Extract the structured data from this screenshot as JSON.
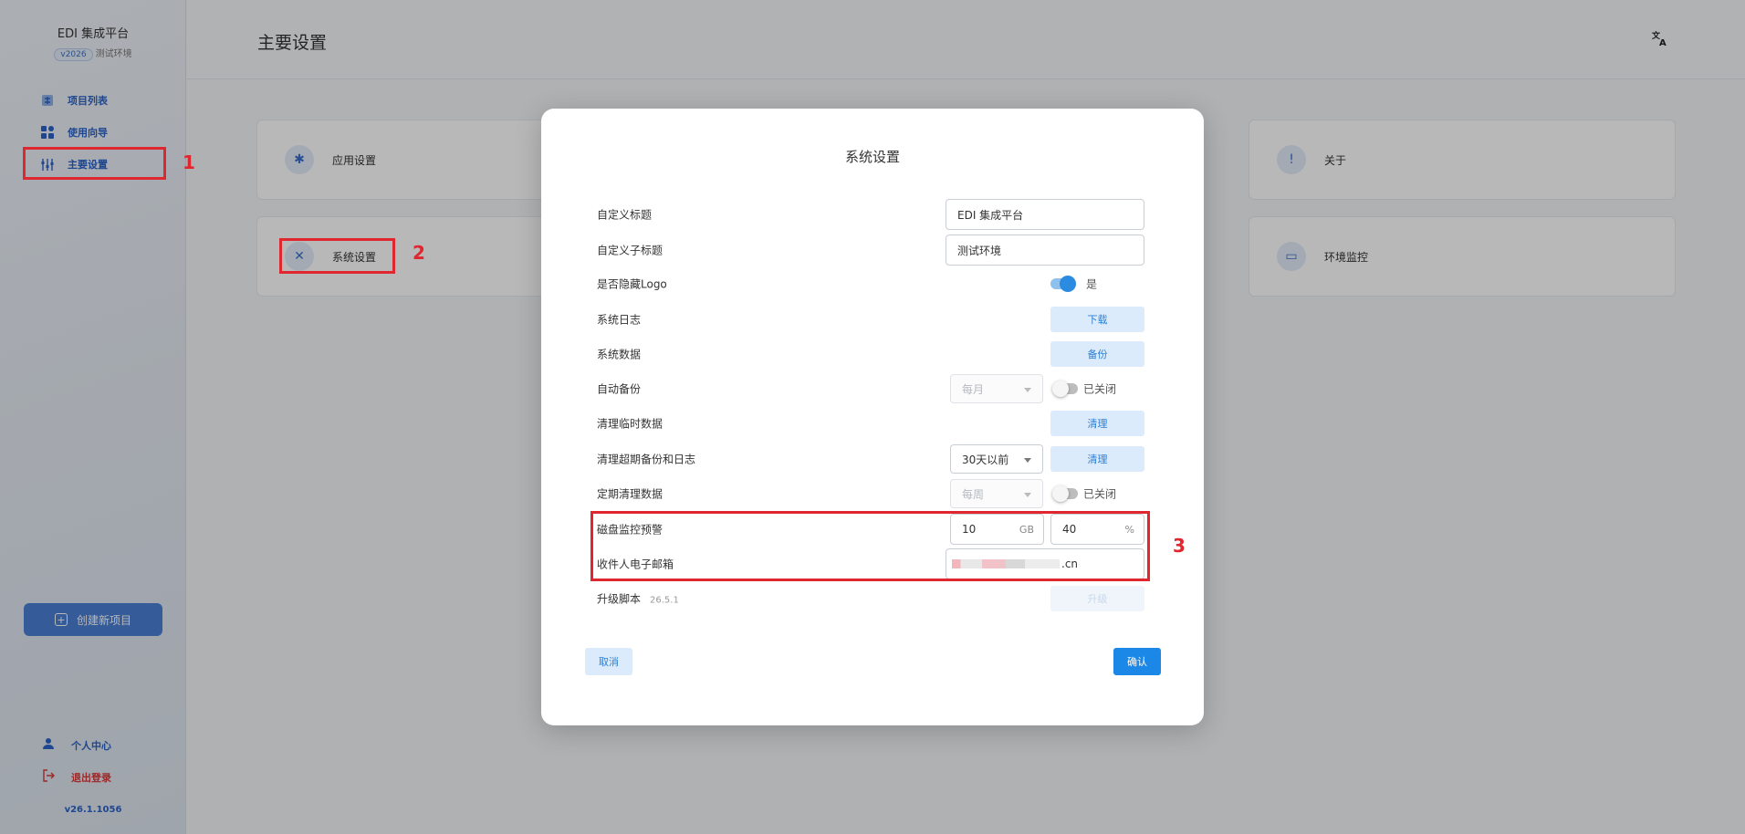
{
  "sidebar": {
    "brand_title": "EDI 集成平台",
    "version_pill": "v2026",
    "env_label": "测试环境",
    "items": [
      {
        "label": "项目列表",
        "icon": "project-list-icon"
      },
      {
        "label": "使用向导",
        "icon": "guide-icon"
      },
      {
        "label": "主要设置",
        "icon": "settings-sliders-icon"
      }
    ],
    "create_label": "创建新项目",
    "profile_label": "个人中心",
    "logout_label": "退出登录",
    "app_version": "v26.1.1056"
  },
  "header": {
    "title": "主要设置",
    "translate_icon": "translate-icon"
  },
  "cards": {
    "app_settings": "应用设置",
    "system_settings": "系统设置",
    "about": "关于",
    "env_monitor": "环境监控"
  },
  "modal": {
    "title": "系统设置",
    "fields": {
      "custom_title_label": "自定义标题",
      "custom_title_value": "EDI 集成平台",
      "custom_subtitle_label": "自定义子标题",
      "custom_subtitle_value": "测试环境",
      "hide_logo_label": "是否隐藏Logo",
      "hide_logo_state": "是",
      "system_log_label": "系统日志",
      "download_label": "下载",
      "system_data_label": "系统数据",
      "backup_label": "备份",
      "auto_backup_label": "自动备份",
      "auto_backup_freq": "每月",
      "auto_backup_state": "已关闭",
      "clean_temp_label": "清理临时数据",
      "clean_label": "清理",
      "clean_expired_label": "清理超期备份和日志",
      "clean_expired_range": "30天以前",
      "clean_expired_btn": "清理",
      "scheduled_clean_label": "定期清理数据",
      "scheduled_clean_freq": "每周",
      "scheduled_clean_state": "已关闭",
      "disk_alert_label": "磁盘监控预警",
      "disk_gb_value": "10",
      "disk_gb_unit": "GB",
      "disk_pct_value": "40",
      "disk_pct_unit": "%",
      "recipient_email_label": "收件人电子邮箱",
      "recipient_email_suffix": ".cn",
      "upgrade_script_label": "升级脚本",
      "upgrade_script_version": "26.5.1",
      "upgrade_label": "升级"
    },
    "cancel_label": "取消",
    "confirm_label": "确认"
  },
  "annotations": {
    "label_1": "1",
    "label_2": "2",
    "label_3": "3",
    "color": "#e0262e"
  }
}
